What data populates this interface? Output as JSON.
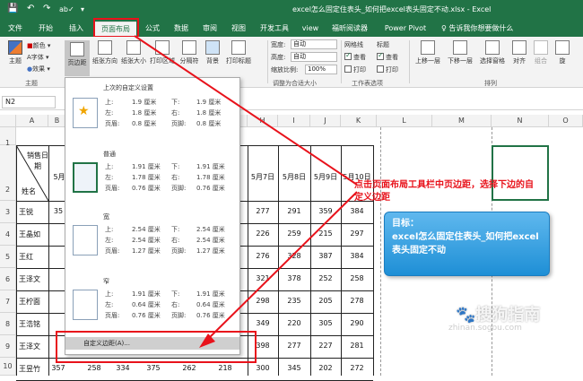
{
  "window": {
    "title": "excel怎么固定住表头_如何把excel表头固定不动.xlsx - Excel",
    "quick_access": [
      "💾",
      "↶",
      "↷",
      "ab✓",
      "▾"
    ]
  },
  "tabs": [
    "文件",
    "开始",
    "插入",
    "页面布局",
    "公式",
    "数据",
    "审阅",
    "视图",
    "开发工具",
    "view",
    "福昕阅读器",
    "Power Pivot"
  ],
  "tell_me": "♀ 告诉我你想要做什么",
  "ribbon": {
    "themes": {
      "label": "主题",
      "small": [
        "颜色 ▾",
        "字体 ▾",
        "效果 ▾"
      ],
      "group": "主题"
    },
    "buttons": [
      "页边距",
      "纸张方向",
      "纸张大小",
      "打印区域",
      "分隔符",
      "背景",
      "打印标题"
    ],
    "scale": {
      "width_label": "宽度:",
      "width_value": "自动",
      "height_label": "高度:",
      "height_value": "自动",
      "zoom_label": "缩放比例:",
      "zoom_value": "100%",
      "group": "调整为合适大小"
    },
    "sheet_options": {
      "gridlines": "网格线",
      "headings": "标题",
      "view": "查看",
      "print": "打印",
      "group": "工作表选项"
    },
    "arrange": {
      "buttons": [
        "上移一层",
        "下移一层",
        "选择窗格",
        "对齐",
        "组合",
        "旋"
      ],
      "group": "排列"
    }
  },
  "name_box": "N2",
  "columns": [
    "A",
    "B",
    "C",
    "D",
    "E",
    "F",
    "G",
    "H",
    "I",
    "J",
    "K",
    "L",
    "M",
    "N",
    "O"
  ],
  "rows": [
    "1",
    "2",
    "3",
    "4",
    "5",
    "6",
    "7",
    "8",
    "9",
    "10"
  ],
  "sheet": {
    "header_top": "销售日期",
    "header_bottom": "姓名",
    "date_headers": [
      "5月",
      "5月7日",
      "5月8日",
      "5月9日",
      "5月10日"
    ],
    "names": [
      "王锐",
      "王晶如",
      "王红",
      "王泽文",
      "王柠面",
      "王浩铭",
      "王泽文",
      "王昱竹"
    ],
    "col_b": [
      "35",
      "",
      "",
      "",
      "",
      "",
      "",
      "357"
    ],
    "col_c_to_g_last": [
      "258",
      "334",
      "375",
      "262",
      "218"
    ],
    "col_h": [
      "277",
      "226",
      "276",
      "321",
      "298",
      "349",
      "398",
      "300"
    ],
    "col_i": [
      "291",
      "259",
      "328",
      "378",
      "235",
      "220",
      "277",
      "345"
    ],
    "col_j": [
      "359",
      "215",
      "387",
      "252",
      "205",
      "305",
      "227",
      "202"
    ],
    "col_k": [
      "384",
      "297",
      "384",
      "258",
      "278",
      "290",
      "281",
      "272"
    ]
  },
  "margins_menu": {
    "presets": [
      {
        "title": "上次的自定义设置",
        "rows": [
          "上:",
          "1.9 厘米",
          "下:",
          "1.9 厘米",
          "左:",
          "1.8 厘米",
          "右:",
          "1.8 厘米",
          "页眉:",
          "0.8 厘米",
          "页脚:",
          "0.8 厘米"
        ]
      },
      {
        "title": "普通",
        "rows": [
          "上:",
          "1.91 厘米",
          "下:",
          "1.91 厘米",
          "左:",
          "1.78 厘米",
          "右:",
          "1.78 厘米",
          "页眉:",
          "0.76 厘米",
          "页脚:",
          "0.76 厘米"
        ]
      },
      {
        "title": "宽",
        "rows": [
          "上:",
          "2.54 厘米",
          "下:",
          "2.54 厘米",
          "左:",
          "2.54 厘米",
          "右:",
          "2.54 厘米",
          "页眉:",
          "1.27 厘米",
          "页脚:",
          "1.27 厘米"
        ]
      },
      {
        "title": "窄",
        "rows": [
          "上:",
          "1.91 厘米",
          "下:",
          "1.91 厘米",
          "左:",
          "0.64 厘米",
          "右:",
          "0.64 厘米",
          "页眉:",
          "0.76 厘米",
          "页脚:",
          "0.76 厘米"
        ]
      }
    ],
    "custom_label": "自定义边距(A)..."
  },
  "annotation": "点击页面布局工具栏中页边距，选择下边的自定义边距",
  "goal_box": {
    "label": "目标：",
    "text": "excel怎么固定住表头_如何把excel表头固定不动"
  },
  "watermark": {
    "brand": "搜狗指南",
    "url": "zhinan.sogou.com"
  },
  "colors": {
    "excel_green": "#217346",
    "annotation_red": "#e8121b",
    "goal_blue": "#1e8fd6"
  }
}
